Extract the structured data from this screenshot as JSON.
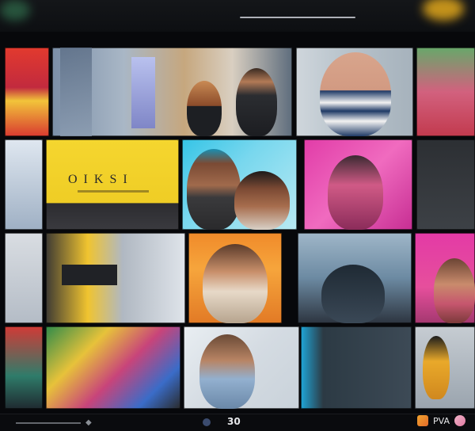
{
  "window": {
    "type": "video-call-gallery"
  },
  "tiles": [
    {
      "id": "r1c1",
      "caption": ""
    },
    {
      "id": "r1c2",
      "caption": ""
    },
    {
      "id": "r1c3",
      "caption": ""
    },
    {
      "id": "r1c4",
      "caption": ""
    },
    {
      "id": "r2c2",
      "caption": "O I K S I"
    },
    {
      "id": "r2c3",
      "caption": ""
    },
    {
      "id": "r2c4",
      "caption": ""
    },
    {
      "id": "r3c2",
      "caption": ""
    },
    {
      "id": "r3c3",
      "caption": ""
    },
    {
      "id": "r3c4",
      "caption": ""
    },
    {
      "id": "r4c2",
      "caption": ""
    },
    {
      "id": "r4c3",
      "caption": ""
    }
  ],
  "bottom_bar": {
    "counter": "30",
    "right_label": "PVA",
    "icons": [
      "participants-icon",
      "reaction-icon",
      "chat-icon"
    ]
  },
  "colors": {
    "accent_yellow": "#f2cf2a",
    "accent_magenta": "#e0359e",
    "accent_cyan": "#3cc8e8",
    "background": "#07080b"
  }
}
